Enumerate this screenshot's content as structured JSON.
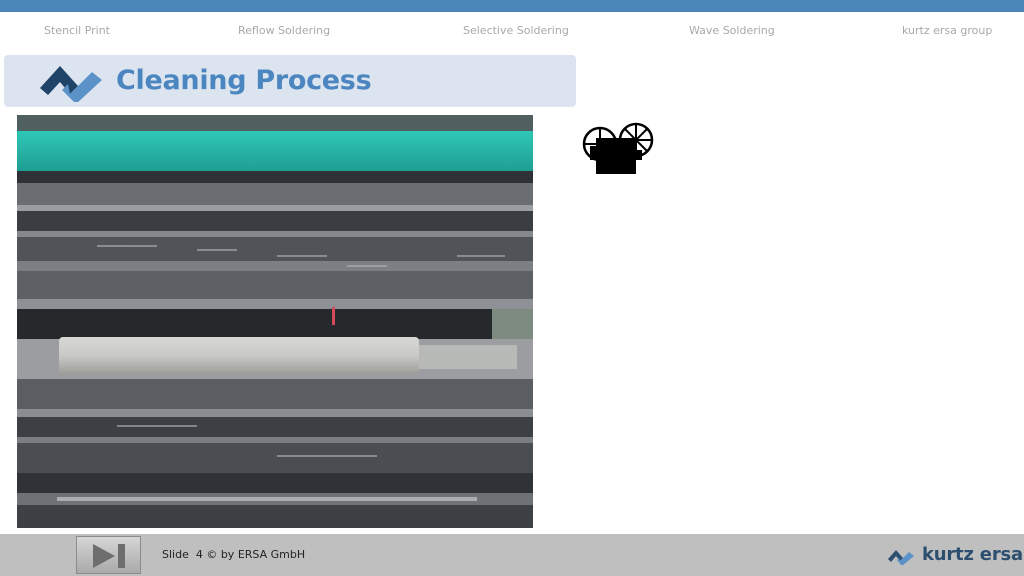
{
  "nav": {
    "items": [
      {
        "label": "Stencil Print"
      },
      {
        "label": "Reflow Soldering"
      },
      {
        "label": "Selective Soldering"
      },
      {
        "label": "Wave Soldering"
      },
      {
        "label": "kurtz ersa group"
      }
    ]
  },
  "header": {
    "title": "Cleaning Process"
  },
  "media": {
    "video_icon": "film-projector-icon",
    "play_icon": "play-next-icon"
  },
  "footer": {
    "slide_info": "Slide  4 © by ERSA GmbH",
    "brand": "kurtz ersa"
  },
  "colors": {
    "accent_bar": "#4a86b8",
    "title_bg": "#dce5ef",
    "title_text": "#4c86c0",
    "logo_dark": "#1f4468",
    "logo_light": "#5b93c9",
    "footer_bg": "#bfbfbf"
  }
}
